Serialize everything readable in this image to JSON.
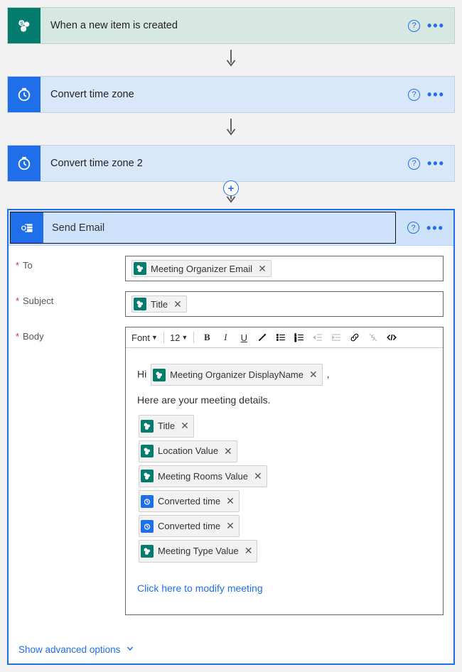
{
  "steps": [
    {
      "title": "When a new item is created"
    },
    {
      "title": "Convert time zone"
    },
    {
      "title": "Convert time zone 2"
    }
  ],
  "sendEmail": {
    "title": "Send Email",
    "labels": {
      "to": "To",
      "subject": "Subject",
      "body": "Body"
    },
    "toolbar": {
      "font": "Font",
      "size": "12"
    },
    "toTokens": [
      {
        "text": "Meeting Organizer Email",
        "icon": "sp"
      }
    ],
    "subjectTokens": [
      {
        "text": "Title",
        "icon": "sp"
      }
    ],
    "body": {
      "greetingPrefix": "Hi ",
      "greetingToken": {
        "text": "Meeting Organizer DisplayName",
        "icon": "sp"
      },
      "greetingSuffix": " ,",
      "intro": "Here are your meeting details.",
      "tokens": [
        {
          "text": "Title",
          "icon": "sp"
        },
        {
          "text": "Location Value",
          "icon": "sp"
        },
        {
          "text": "Meeting Rooms Value",
          "icon": "sp"
        },
        {
          "text": "Converted time",
          "icon": "tm"
        },
        {
          "text": "Converted time",
          "icon": "tm"
        },
        {
          "text": "Meeting Type Value",
          "icon": "sp"
        }
      ],
      "link": "Click here to modify meeting"
    },
    "advanced": "Show advanced options"
  }
}
